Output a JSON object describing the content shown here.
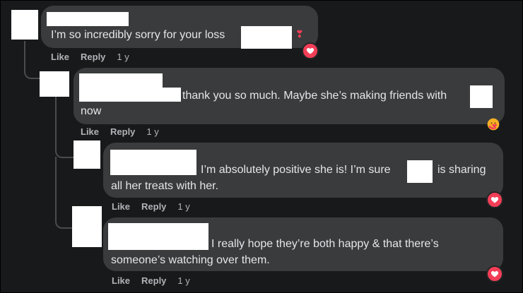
{
  "comments": [
    {
      "text_line1": "I’m so incredibly sorry for your loss",
      "text_line2": "",
      "like": "Like",
      "reply": "Reply",
      "time": "1 y",
      "reaction": "love-icon"
    },
    {
      "text_line1": "thank you so much. Maybe she’s making friends with",
      "text_line2": "now",
      "like": "Like",
      "reply": "Reply",
      "time": "1 y",
      "reaction": "care-icon"
    },
    {
      "text_line1": "I’m absolutely positive she is! I’m sure",
      "text_line1b": "is sharing",
      "text_line2": "all her treats with her.",
      "like": "Like",
      "reply": "Reply",
      "time": "1 y",
      "reaction": "love-icon"
    },
    {
      "text_line1": "I really hope they’re both happy & that there’s",
      "text_line2": "someone’s watching over them.",
      "like": "Like",
      "reply": "Reply",
      "time": "1 y",
      "reaction": "love-icon"
    }
  ],
  "colors": {
    "background": "#18191a",
    "bubble": "#3a3b3c",
    "text": "#e4e6eb",
    "meta": "#b0b3b8",
    "love": "#f33e58"
  }
}
